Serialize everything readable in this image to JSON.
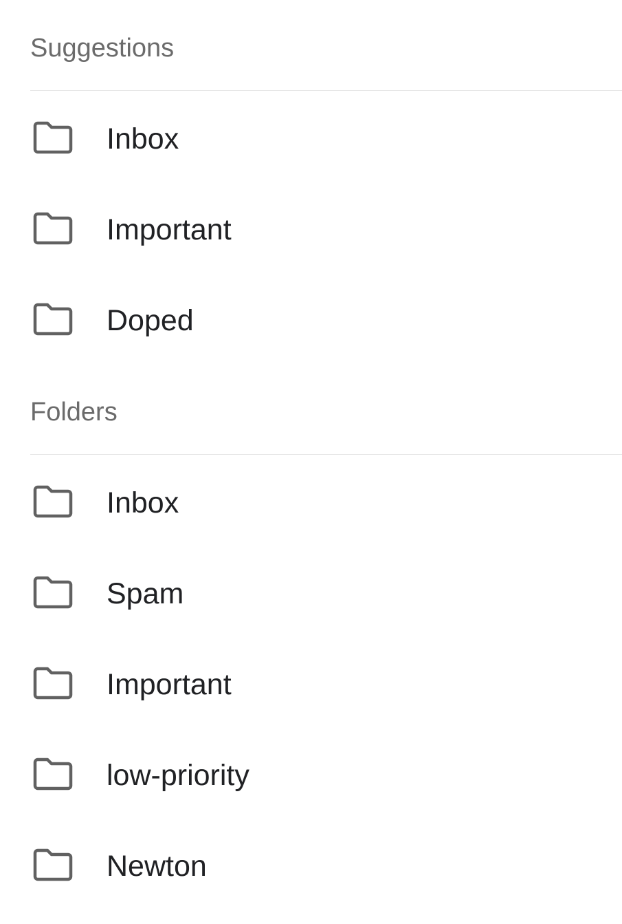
{
  "suggestions": {
    "header": "Suggestions",
    "items": [
      {
        "label": "Inbox",
        "icon": "folder-icon"
      },
      {
        "label": "Important",
        "icon": "folder-icon"
      },
      {
        "label": "Doped",
        "icon": "folder-icon"
      }
    ]
  },
  "folders": {
    "header": "Folders",
    "items": [
      {
        "label": "Inbox",
        "icon": "folder-icon"
      },
      {
        "label": "Spam",
        "icon": "folder-icon"
      },
      {
        "label": "Important",
        "icon": "folder-icon"
      },
      {
        "label": "low-priority",
        "icon": "folder-icon"
      },
      {
        "label": "Newton",
        "icon": "folder-icon"
      }
    ]
  },
  "colors": {
    "header_text": "#6b6b6b",
    "item_text": "#202124",
    "icon": "#616161",
    "divider": "#e6e6e6",
    "background": "#ffffff"
  }
}
